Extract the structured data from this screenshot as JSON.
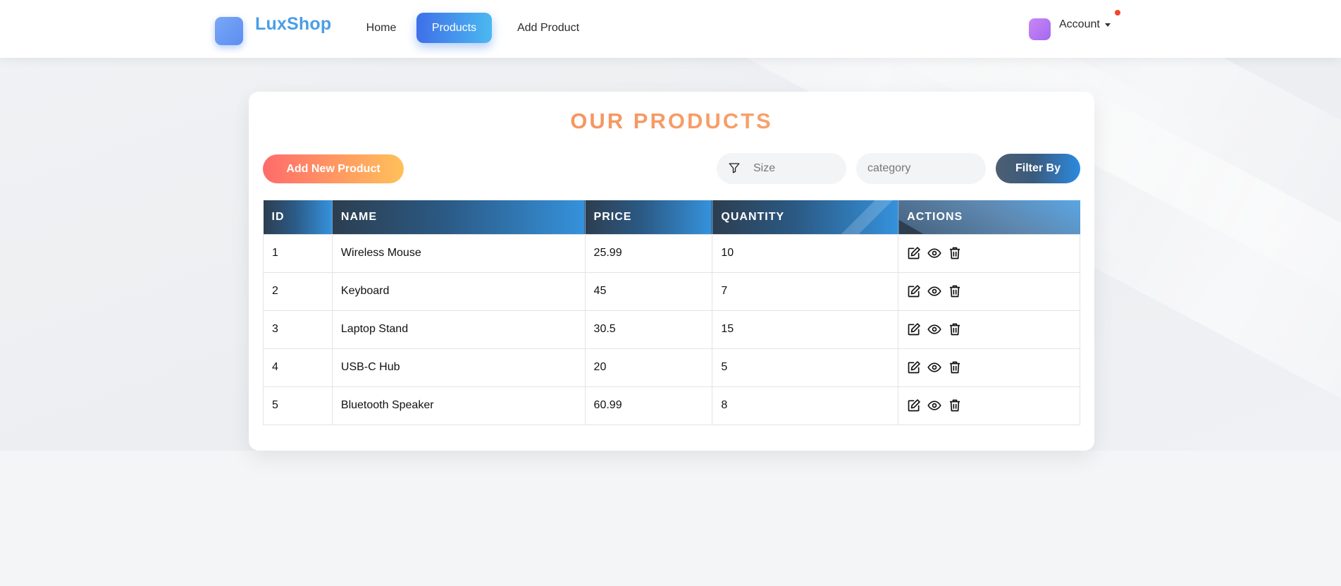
{
  "navbar": {
    "brand": "LuxShop",
    "links": [
      {
        "label": "Home",
        "active": false
      },
      {
        "label": "Products",
        "active": true
      },
      {
        "label": "Add Product",
        "active": false
      }
    ],
    "account_label": "Account",
    "has_notification": true
  },
  "page": {
    "title": "OUR PRODUCTS",
    "add_button": "Add New Product",
    "filter": {
      "size_placeholder": "Size",
      "category_placeholder": "category",
      "button_label": "Filter By"
    }
  },
  "table": {
    "headers": [
      "ID",
      "NAME",
      "PRICE",
      "QUANTITY",
      "ACTIONS"
    ],
    "rows": [
      {
        "id": "1",
        "name": "Wireless Mouse",
        "price": "25.99",
        "quantity": "10"
      },
      {
        "id": "2",
        "name": "Keyboard",
        "price": "45",
        "quantity": "7"
      },
      {
        "id": "3",
        "name": "Laptop Stand",
        "price": "30.5",
        "quantity": "15"
      },
      {
        "id": "4",
        "name": "USB-C Hub",
        "price": "20",
        "quantity": "5"
      },
      {
        "id": "5",
        "name": "Bluetooth Speaker",
        "price": "60.99",
        "quantity": "8"
      }
    ],
    "row_actions": [
      "edit-icon",
      "view-icon",
      "delete-icon"
    ]
  },
  "colors": {
    "brand": "#4b9ee6",
    "nav_active_start": "#3f6fe9",
    "nav_active_end": "#4bb9f0",
    "title_gradient_start": "#f5834e",
    "add_button_start": "#ff6b6b",
    "add_button_end": "#ffc15a",
    "table_header_start": "#2c3e50",
    "table_header_end": "#3592dc",
    "notification": "#f0472b"
  }
}
